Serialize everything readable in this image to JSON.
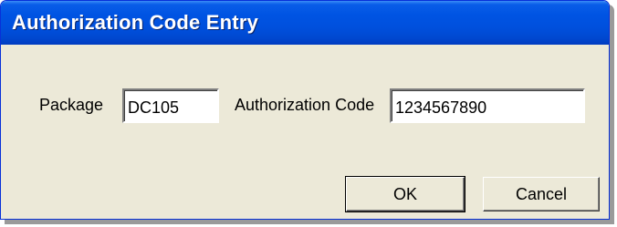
{
  "window": {
    "title": "Authorization Code Entry"
  },
  "form": {
    "package_label": "Package",
    "package_value": "DC105",
    "auth_label": "Authorization Code",
    "auth_value": "1234567890"
  },
  "buttons": {
    "ok_label": "OK",
    "cancel_label": "Cancel"
  }
}
